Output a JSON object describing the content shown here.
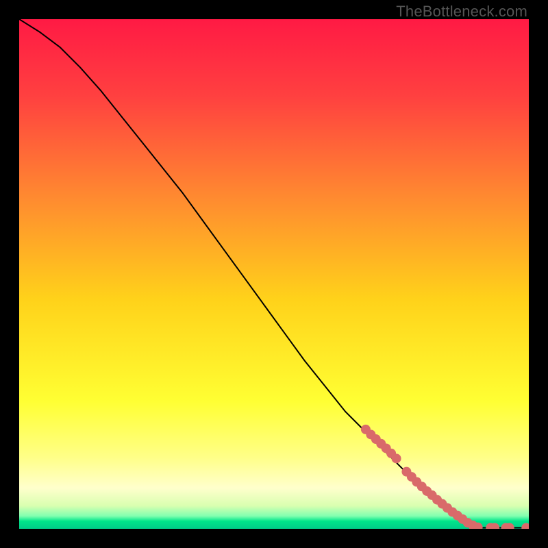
{
  "watermark": "TheBottleneck.com",
  "colors": {
    "frame": "#000000",
    "marker_fill": "#d96a6a",
    "marker_stroke": "#b44",
    "line": "#000000",
    "gradient_stops": [
      {
        "offset": 0.0,
        "color": "#ff1a44"
      },
      {
        "offset": 0.15,
        "color": "#ff4040"
      },
      {
        "offset": 0.35,
        "color": "#ff8a30"
      },
      {
        "offset": 0.55,
        "color": "#ffd21a"
      },
      {
        "offset": 0.75,
        "color": "#ffff33"
      },
      {
        "offset": 0.86,
        "color": "#ffff88"
      },
      {
        "offset": 0.92,
        "color": "#ffffcc"
      },
      {
        "offset": 0.955,
        "color": "#d9ffb0"
      },
      {
        "offset": 0.975,
        "color": "#80ffb0"
      },
      {
        "offset": 0.985,
        "color": "#00e58a"
      },
      {
        "offset": 1.0,
        "color": "#00cc88"
      }
    ]
  },
  "chart_data": {
    "type": "line",
    "title": "",
    "xlabel": "",
    "ylabel": "",
    "xlim": [
      0,
      100
    ],
    "ylim": [
      0,
      100
    ],
    "series": [
      {
        "name": "curve",
        "x": [
          0,
          4,
          8,
          12,
          16,
          20,
          24,
          28,
          32,
          36,
          40,
          44,
          48,
          52,
          56,
          60,
          64,
          68,
          72,
          76,
          80,
          84,
          86,
          88,
          89.5,
          90,
          91,
          92,
          93,
          94,
          95,
          96,
          97,
          98,
          99,
          100
        ],
        "y": [
          100,
          97.5,
          94.5,
          90.5,
          86,
          81,
          76,
          71,
          66,
          60.5,
          55,
          49.5,
          44,
          38.5,
          33,
          28,
          23,
          19,
          15,
          11,
          7.5,
          4,
          2.5,
          1.2,
          0.5,
          0.2,
          0.2,
          0.2,
          0.2,
          0.2,
          0.2,
          0.2,
          0.2,
          0.2,
          0.2,
          0.2
        ]
      }
    ],
    "points": [
      {
        "x": 68,
        "y": 19.5
      },
      {
        "x": 69,
        "y": 18.5
      },
      {
        "x": 70,
        "y": 17.6
      },
      {
        "x": 71,
        "y": 16.7
      },
      {
        "x": 72,
        "y": 15.8
      },
      {
        "x": 73,
        "y": 14.8
      },
      {
        "x": 74,
        "y": 13.8
      },
      {
        "x": 76,
        "y": 11.2
      },
      {
        "x": 77,
        "y": 10.2
      },
      {
        "x": 78,
        "y": 9.2
      },
      {
        "x": 79,
        "y": 8.3
      },
      {
        "x": 80,
        "y": 7.4
      },
      {
        "x": 81,
        "y": 6.6
      },
      {
        "x": 82,
        "y": 5.7
      },
      {
        "x": 83,
        "y": 4.9
      },
      {
        "x": 84,
        "y": 4.1
      },
      {
        "x": 85,
        "y": 3.3
      },
      {
        "x": 86,
        "y": 2.6
      },
      {
        "x": 87,
        "y": 1.9
      },
      {
        "x": 88,
        "y": 1.2
      },
      {
        "x": 89,
        "y": 0.7
      },
      {
        "x": 90,
        "y": 0.3
      },
      {
        "x": 92.5,
        "y": 0.2
      },
      {
        "x": 93.3,
        "y": 0.2
      },
      {
        "x": 95.5,
        "y": 0.2
      },
      {
        "x": 96.2,
        "y": 0.2
      },
      {
        "x": 99.5,
        "y": 0.2
      }
    ]
  }
}
